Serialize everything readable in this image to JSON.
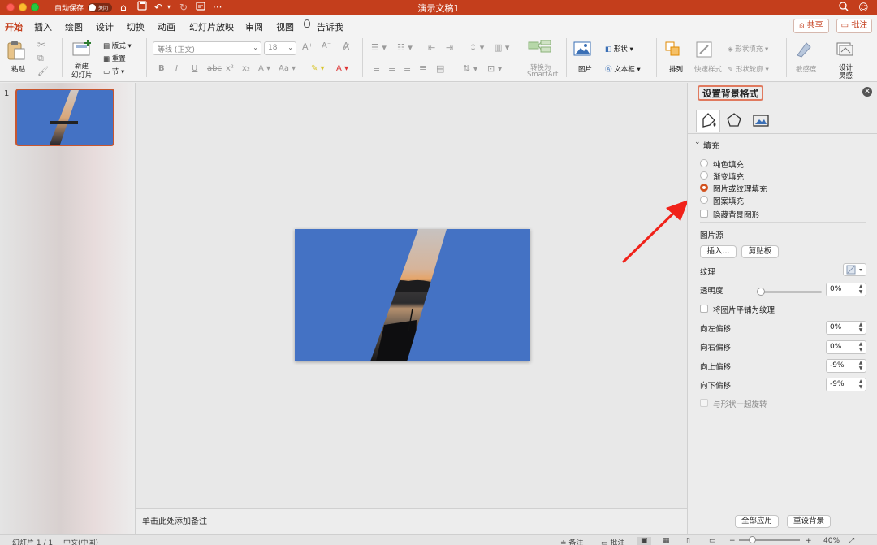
{
  "titlebar": {
    "autosave_label": "自动保存",
    "autosave_state": "关闭",
    "window_title": "演示文稿1",
    "bg_color": "#c43e1c"
  },
  "tabs": [
    {
      "label": "开始",
      "active": true
    },
    {
      "label": "插入"
    },
    {
      "label": "绘图"
    },
    {
      "label": "设计"
    },
    {
      "label": "切换"
    },
    {
      "label": "动画"
    },
    {
      "label": "幻灯片放映"
    },
    {
      "label": "审阅"
    },
    {
      "label": "视图"
    }
  ],
  "tell_me": "告诉我",
  "share_label": "共享",
  "comment_label": "批注",
  "ribbon": {
    "paste": "粘贴",
    "new_slide_1": "新建",
    "new_slide_2": "幻灯片",
    "layout": "版式",
    "reset": "重置",
    "section": "节",
    "font_name": "等线 (正文)",
    "font_size": "18",
    "smartart_1": "转换为",
    "smartart_2": "SmartArt",
    "picture": "图片",
    "shape": "形状",
    "textbox": "文本框",
    "arrange": "排列",
    "quick_styles": "快速样式",
    "shape_fill": "形状填充",
    "shape_outline": "形状轮廓",
    "sensitivity": "敏感度",
    "designer_1": "设计",
    "designer_2": "灵感"
  },
  "thumbnail": {
    "number": "1"
  },
  "notes_placeholder": "单击此处添加备注",
  "format_pane": {
    "title": "设置背景格式",
    "tab_icons": [
      "fill-bucket-icon",
      "pentagon-icon",
      "picture-icon"
    ],
    "section_title": "填充",
    "fill_options": [
      {
        "label": "纯色填充",
        "selected": false
      },
      {
        "label": "渐变填充",
        "selected": false
      },
      {
        "label": "图片或纹理填充",
        "selected": true
      },
      {
        "label": "图案填充",
        "selected": false
      }
    ],
    "hide_bg_graphics": "隐藏背景图形",
    "picture_source": "图片源",
    "insert_btn": "插入...",
    "clipboard_btn": "剪贴板",
    "texture": "纹理",
    "transparency": "透明度",
    "transparency_value": "0%",
    "transparency_level": 0,
    "tile_as_texture": "将图片平铺为纹理",
    "offsets": [
      {
        "label": "向左偏移",
        "value": "0%"
      },
      {
        "label": "向右偏移",
        "value": "0%"
      },
      {
        "label": "向上偏移",
        "value": "-9%"
      },
      {
        "label": "向下偏移",
        "value": "-9%"
      }
    ],
    "rotate_with_shape": "与形状一起旋转",
    "apply_all": "全部应用",
    "reset_bg": "重设背景",
    "accent_color": "#d2521f"
  },
  "statusbar": {
    "slide_info": "幻灯片 1 / 1",
    "language": "中文(中国)",
    "notes": "备注",
    "comments": "批注",
    "zoom": "40%"
  },
  "slide": {
    "bg_color": "#4472c4"
  }
}
